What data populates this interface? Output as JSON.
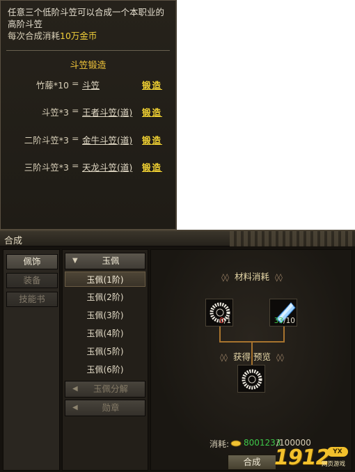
{
  "tooltip": {
    "desc": "任意三个低阶斗笠可以合成一个本职业的高阶斗笠",
    "cost_prefix": "每次合成消耗",
    "cost_value": "10万金币",
    "section_title": "斗笠锻造",
    "recipes": [
      {
        "lhs": "竹藤*10",
        "eq": "=",
        "rhs": "斗笠",
        "action": "锻造"
      },
      {
        "lhs": "斗笠*3",
        "eq": "=",
        "rhs": "王者斗笠(道)",
        "action": "锻造"
      },
      {
        "lhs": "二阶斗笠*3",
        "eq": "=",
        "rhs": "金牛斗笠(道)",
        "action": "锻造"
      },
      {
        "lhs": "三阶斗笠*3",
        "eq": "=",
        "rhs": "天龙斗笠(道)",
        "action": "锻造"
      }
    ]
  },
  "window": {
    "title": "合成",
    "categories": [
      {
        "label": "佩饰",
        "state": "active"
      },
      {
        "label": "装备",
        "state": "off"
      },
      {
        "label": "技能书",
        "state": "off"
      }
    ],
    "group_open": {
      "label": "玉佩"
    },
    "items": [
      {
        "label": "玉佩(1阶)",
        "selected": true
      },
      {
        "label": "玉佩(2阶)",
        "selected": false
      },
      {
        "label": "玉佩(3阶)",
        "selected": false
      },
      {
        "label": "玉佩(4阶)",
        "selected": false
      },
      {
        "label": "玉佩(5阶)",
        "selected": false
      },
      {
        "label": "玉佩(6阶)",
        "selected": false
      }
    ],
    "group_collapsed": [
      {
        "label": "玉佩分解"
      },
      {
        "label": "勋章"
      }
    ],
    "materials_title": "材料消耗",
    "materials": [
      {
        "icon": "jade-ring-icon",
        "have": "0",
        "need": "1"
      },
      {
        "icon": "blue-crystal-icon",
        "have": "33",
        "need": "10"
      }
    ],
    "preview_title": "获得 预览",
    "result_icon": "jade-ring-icon",
    "cost_label": "消耗:",
    "cost_have": "8001233",
    "cost_need": "/100000",
    "craft_button": "合成"
  },
  "logo": {
    "number": "1912",
    "badge": "YX",
    "subtitle": "网页游戏"
  },
  "colors": {
    "accent_gold": "#f5d533",
    "ok_green": "#3ec94a",
    "warn_red": "#e0322a",
    "wire": "#a8742e"
  }
}
